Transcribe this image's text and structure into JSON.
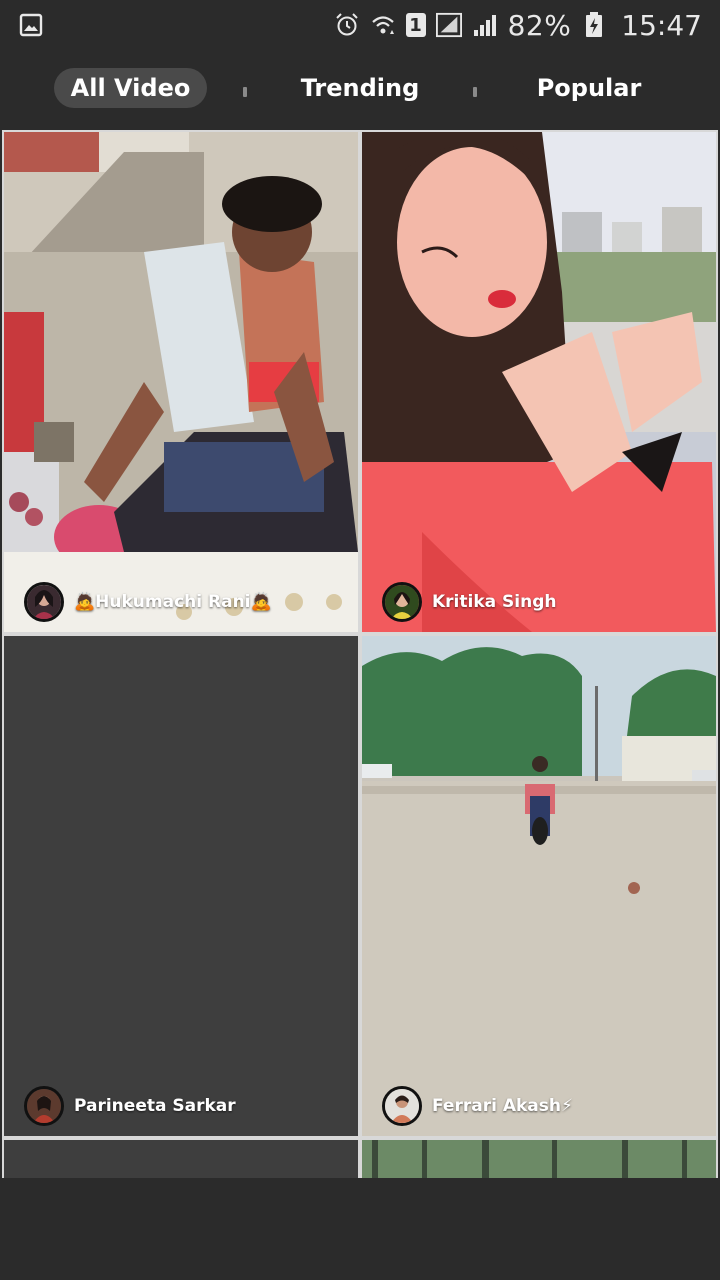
{
  "status_bar": {
    "battery_percent": "82%",
    "time": "15:47",
    "sim_slot": "1",
    "icons": [
      "gallery-notification-icon",
      "alarm-icon",
      "wifi-icon",
      "sim-1-icon",
      "signal-icon",
      "signal-icon",
      "battery-charging-icon"
    ]
  },
  "tabs": [
    {
      "label": "All Video",
      "active": true
    },
    {
      "label": "Trending",
      "active": false
    },
    {
      "label": "Popular",
      "active": false
    }
  ],
  "videos": [
    {
      "author": "🙇Hukumachi Rani🙇"
    },
    {
      "author": "Kritika Singh"
    },
    {
      "author": "Parineeta Sarkar"
    },
    {
      "author": "Ferrari Akash⚡"
    }
  ],
  "colors": {
    "background": "#2b2b2b",
    "active_tab": "#4a4a4a",
    "placeholder_card": "#3e3e3e"
  }
}
